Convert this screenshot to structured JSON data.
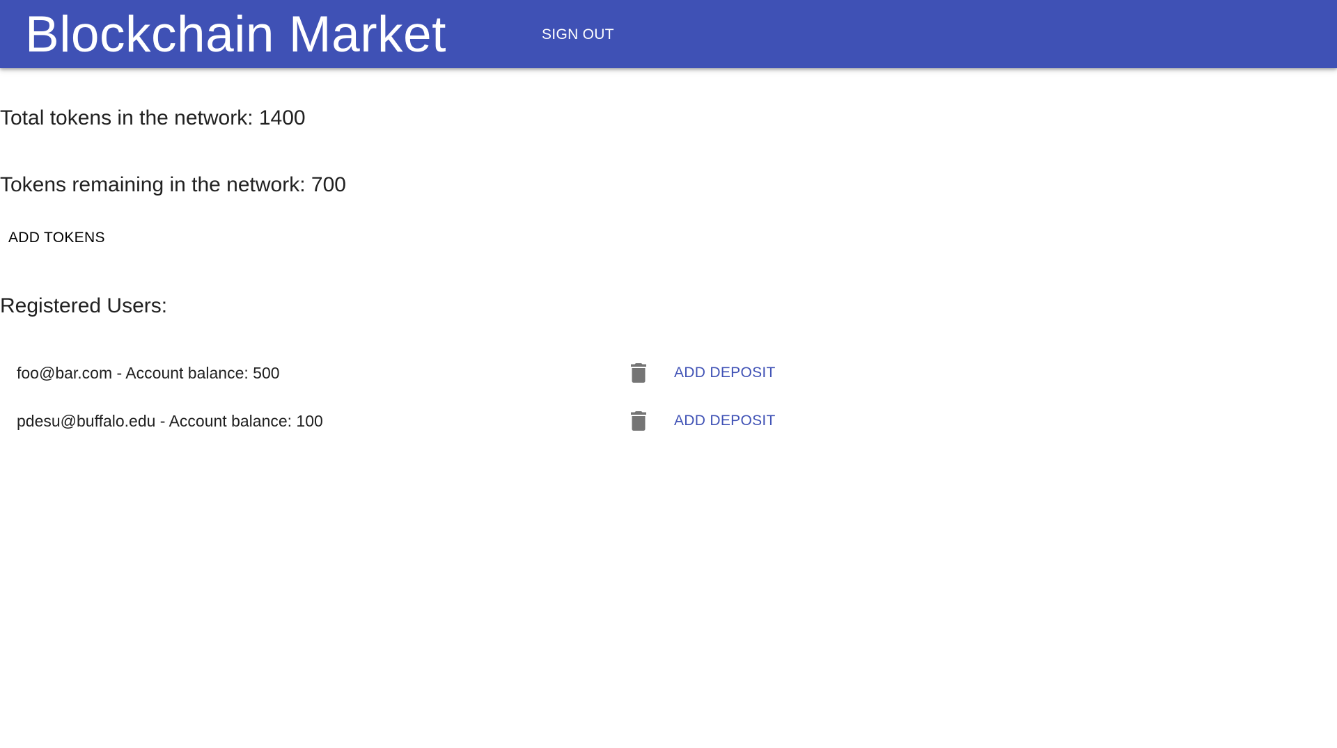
{
  "header": {
    "title": "Blockchain Market",
    "signout_label": "SIGN OUT",
    "background_color": "#3f51b5"
  },
  "stats": {
    "total_text": "Total tokens in the network: 1400",
    "remaining_text": "Tokens remaining in the network: 700"
  },
  "actions": {
    "add_tokens_label": "ADD TOKENS"
  },
  "users": {
    "heading": "Registered Users:",
    "items": [
      {
        "text": "foo@bar.com - Account balance: 500",
        "delete_icon": "trash-icon",
        "deposit_label": "ADD DEPOSIT"
      },
      {
        "text": "pdesu@buffalo.edu - Account balance: 100",
        "delete_icon": "trash-icon",
        "deposit_label": "ADD DEPOSIT"
      }
    ]
  },
  "colors": {
    "primary": "#3f51b5",
    "icon_gray": "#757575"
  }
}
